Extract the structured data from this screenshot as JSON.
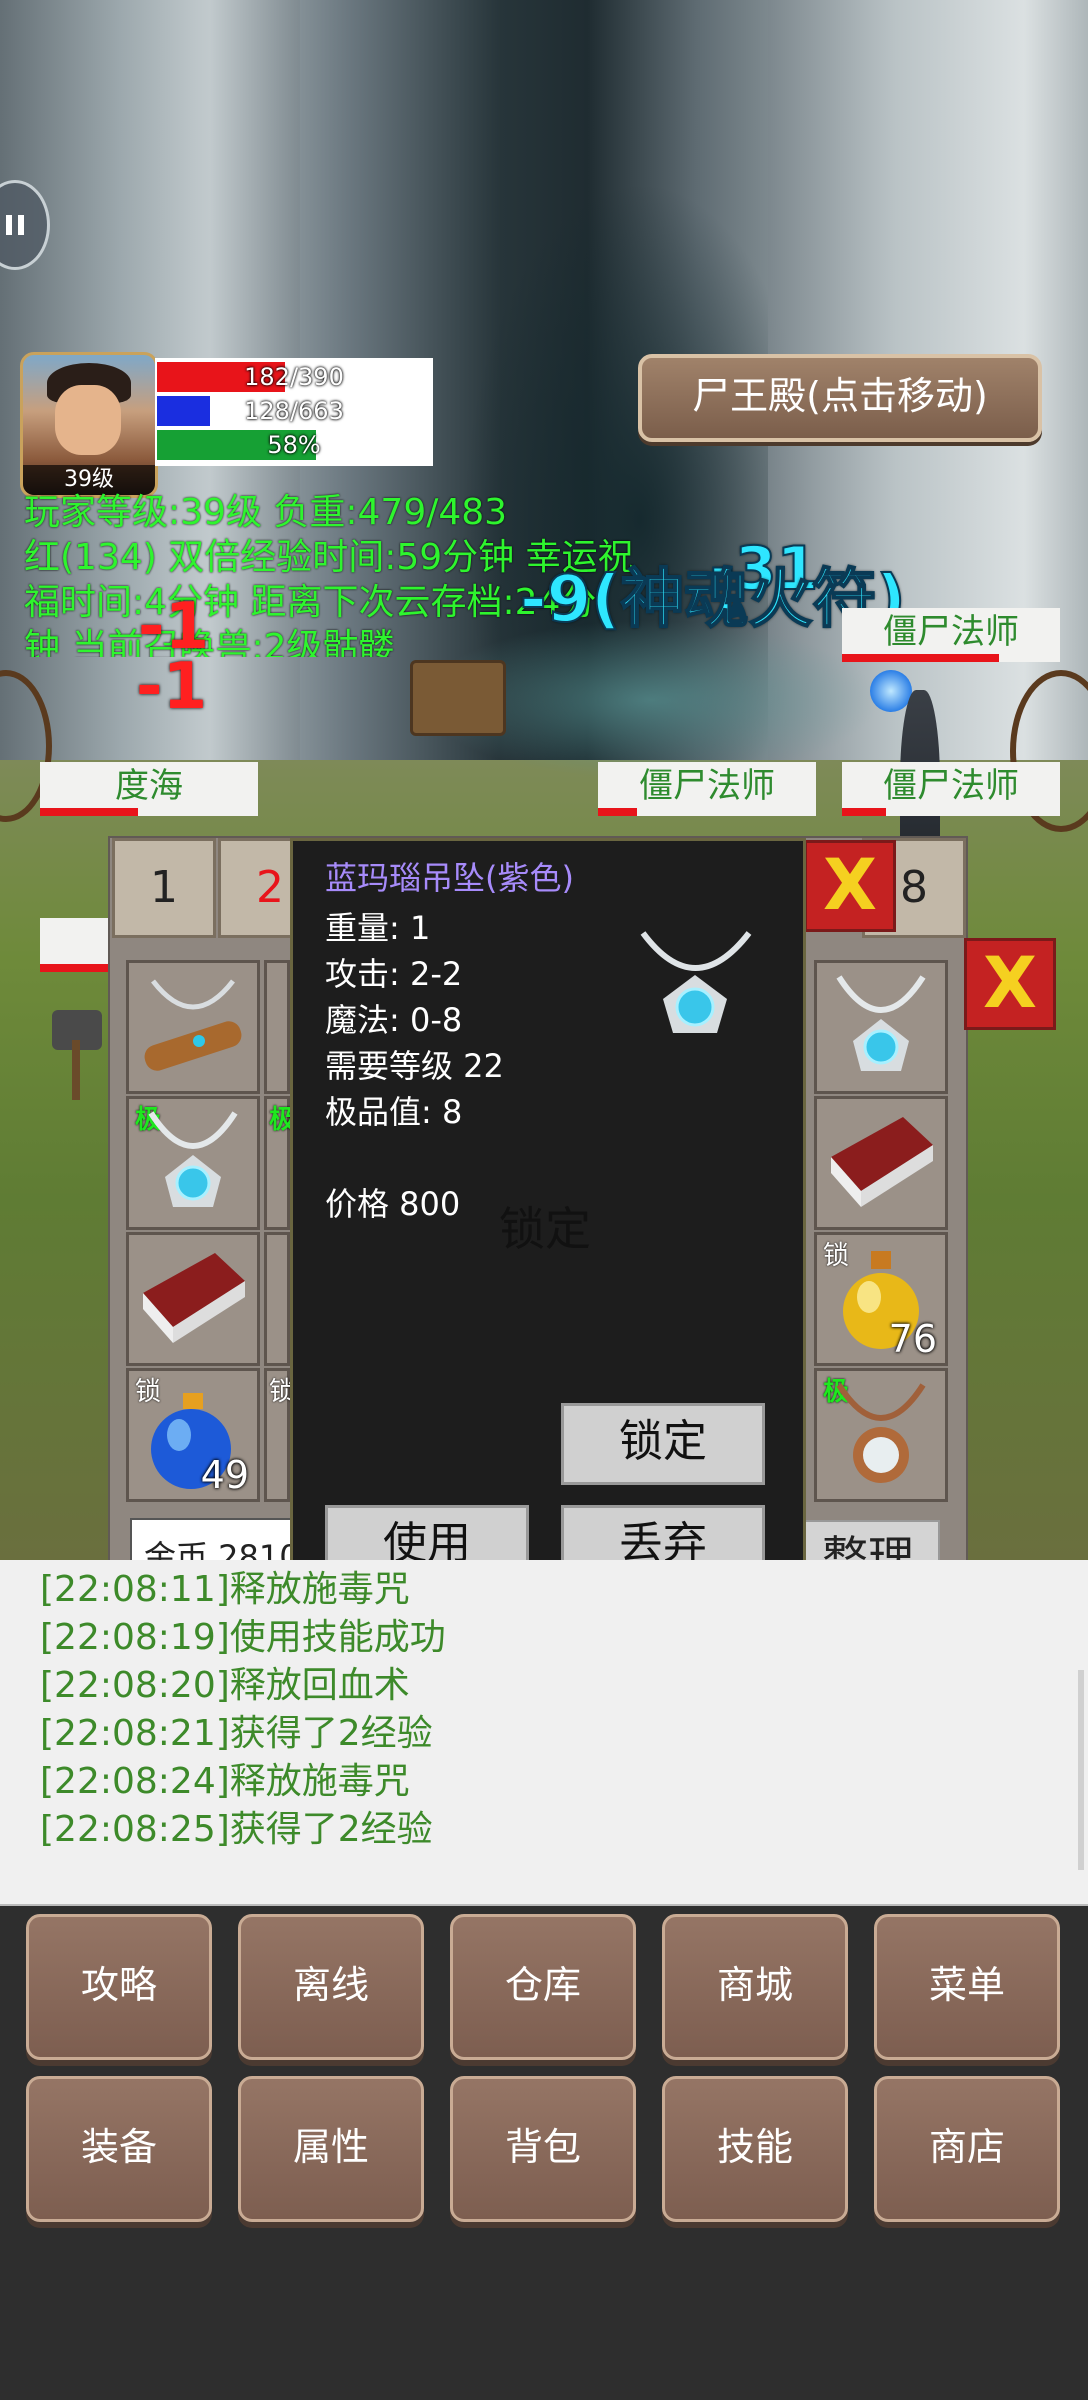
{
  "player": {
    "level_badge": "39级",
    "hp": "182/390",
    "hp_fraction": 0.467,
    "mp": "128/663",
    "mp_fraction": 0.193,
    "exp": "58%",
    "exp_fraction": 0.58
  },
  "location_button": "尸王殿(点击移动)",
  "info_lines": [
    "玩家等级:39级 负重:479/483",
    "红(134) 双倍经验时间:59分钟 幸运祝",
    "福时间:4分钟 距离下次云存档:24分",
    "钟 当前召唤兽:2级骷髅"
  ],
  "damage_texts": [
    "-1",
    "-1",
    "-9(神魂火符)",
    "-31"
  ],
  "monsters": [
    {
      "name": "僵尸法师",
      "hp_fraction": 0.72
    },
    {
      "name": "度海",
      "hp_fraction": 0.45
    },
    {
      "name": "僵尸法师",
      "hp_fraction": 0.18
    },
    {
      "name": "僵尸法师",
      "hp_fraction": 0.2
    }
  ],
  "inventory": {
    "tabs": [
      "1",
      "2",
      "8"
    ],
    "active_tab": "2",
    "gold": "金币 2810",
    "sort_label": "整理",
    "slots_left": [
      {
        "tag": "",
        "item": "wooden-flute"
      },
      {
        "tag": "极",
        "item": "blue-gem-necklace"
      },
      {
        "tag": "",
        "item": "book"
      },
      {
        "tag": "锁",
        "item": "blue-potion",
        "count": "49"
      }
    ],
    "slots_right": [
      {
        "tag": "",
        "item": "blue-gem-necklace"
      },
      {
        "tag": "",
        "item": "book"
      },
      {
        "tag": "锁",
        "item": "yellow-potion",
        "count": "76"
      },
      {
        "tag": "极",
        "item": "copper-mirror-necklace"
      }
    ],
    "partial_tags": [
      "极",
      "锁"
    ]
  },
  "item_popup": {
    "name": "蓝玛瑙吊坠(紫色)",
    "weight": "重量: 1",
    "attack": "攻击: 2-2",
    "magic": "魔法: 0-8",
    "required_level": "需要等级 22",
    "quality": "极品值: 8",
    "price": "价格 800",
    "locked_watermark": "锁定",
    "lock_button": "锁定",
    "use_button": "使用",
    "drop_button": "丢弃"
  },
  "log": [
    "[22:08:11]释放施毒咒",
    "[22:08:19]使用技能成功",
    "[22:08:20]释放回血术",
    "[22:08:21]获得了2经验",
    "[22:08:24]释放施毒咒",
    "[22:08:25]获得了2经验"
  ],
  "menu_row1": [
    "攻略",
    "离线",
    "仓库",
    "商城",
    "菜单"
  ],
  "menu_row2": [
    "装备",
    "属性",
    "背包",
    "技能",
    "商店"
  ],
  "colors": {
    "hp": "#e8141a",
    "mp": "#1a2ee0",
    "exp": "#16a034",
    "info_text": "#2ef52e",
    "skill_text": "#2ee6ff",
    "item_name_purple": "#a78bfa",
    "log_text": "#3d8a2a",
    "menu_button": "#8a6a5a"
  }
}
